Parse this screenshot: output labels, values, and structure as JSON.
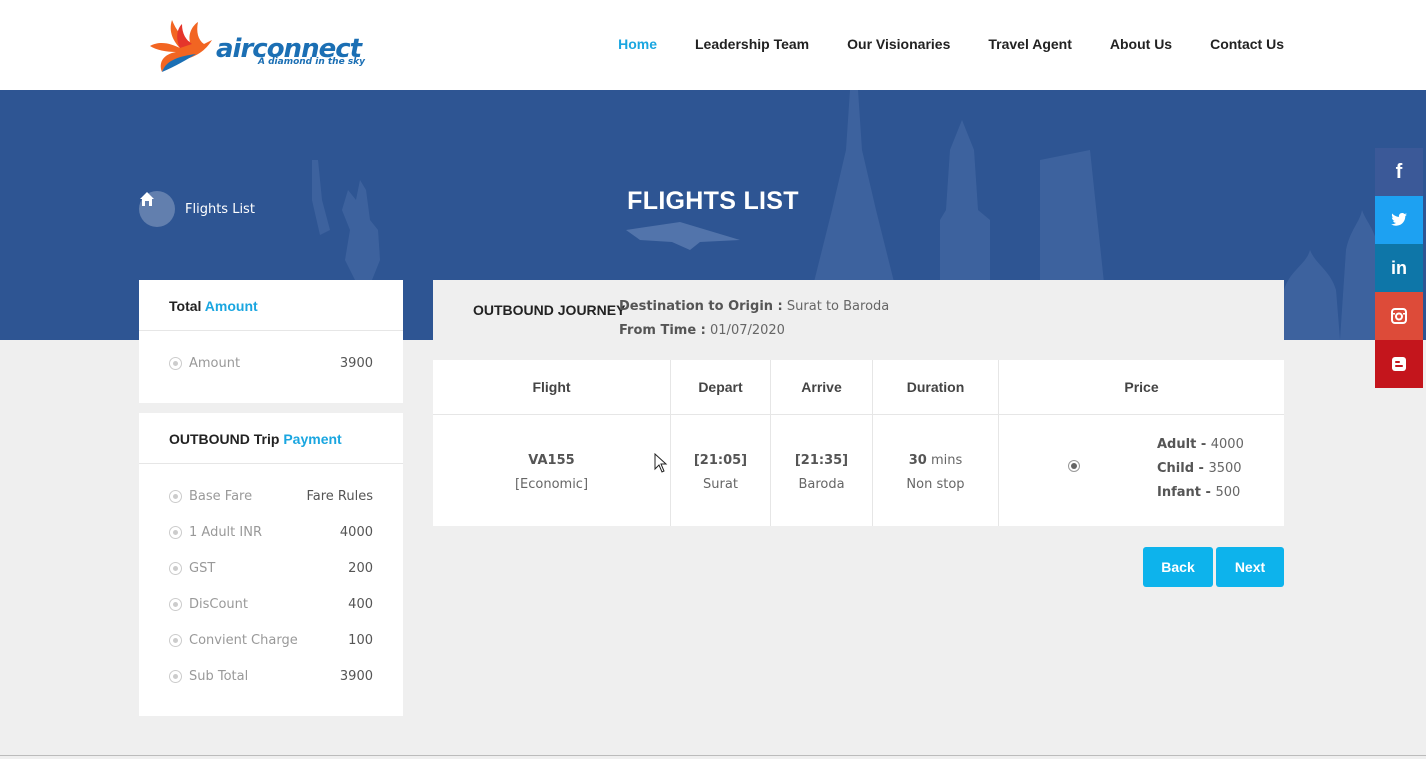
{
  "brand": {
    "name": "airconnect",
    "tagline": "A diamond in the sky"
  },
  "nav": {
    "items": [
      "Home",
      "Leadership Team",
      "Our Visionaries",
      "Travel Agent",
      "About Us",
      "Contact Us"
    ],
    "active": "Home"
  },
  "banner": {
    "title": "FLIGHTS LIST",
    "breadcrumb": "Flights List"
  },
  "social": [
    {
      "icon": "facebook-icon",
      "glyph": "f",
      "color": "#3b5998"
    },
    {
      "icon": "twitter-icon",
      "glyph": "🐦",
      "color": "#1da1f2"
    },
    {
      "icon": "linkedin-icon",
      "glyph": "in",
      "color": "#0e76a8"
    },
    {
      "icon": "instagram-icon",
      "glyph": "◘",
      "color": "#dd4b39"
    },
    {
      "icon": "blogger-icon",
      "glyph": "B",
      "color": "#c4151c"
    }
  ],
  "total_card": {
    "title_main": "Total",
    "title_accent": "Amount",
    "rows": [
      {
        "label": "Amount",
        "value": "3900"
      }
    ]
  },
  "payment_card": {
    "title_main": "OUTBOUND Trip",
    "title_accent": "Payment",
    "rows": [
      {
        "label": "Base Fare",
        "value": "Fare Rules"
      },
      {
        "label": "1 Adult INR",
        "value": "4000"
      },
      {
        "label": "GST",
        "value": "200"
      },
      {
        "label": "DisCount",
        "value": "400"
      },
      {
        "label": "Convient Charge",
        "value": "100"
      },
      {
        "label": "Sub Total",
        "value": "3900"
      }
    ]
  },
  "journey": {
    "title": "OUTBOUND JOURNEY",
    "dest_label": "Destination to Origin :",
    "dest_value": "Surat to Baroda",
    "time_label": "From Time :",
    "time_value": "01/07/2020"
  },
  "table": {
    "headers": [
      "Flight",
      "Depart",
      "Arrive",
      "Duration",
      "Price"
    ],
    "row": {
      "flight_no": "VA155",
      "flight_class": "[Economic]",
      "depart_time": "[21:05]",
      "depart_city": "Surat",
      "arrive_time": "[21:35]",
      "arrive_city": "Baroda",
      "duration_num": "30",
      "duration_unit": "mins",
      "stops": "Non stop",
      "prices": [
        {
          "label": "Adult",
          "value": "4000"
        },
        {
          "label": "Child",
          "value": "3500"
        },
        {
          "label": "Infant",
          "value": "500"
        }
      ]
    }
  },
  "buttons": {
    "back": "Back",
    "next": "Next"
  },
  "colors": {
    "accent": "#1aa6e0",
    "button": "#0db3ec",
    "banner": "#2e5593"
  }
}
